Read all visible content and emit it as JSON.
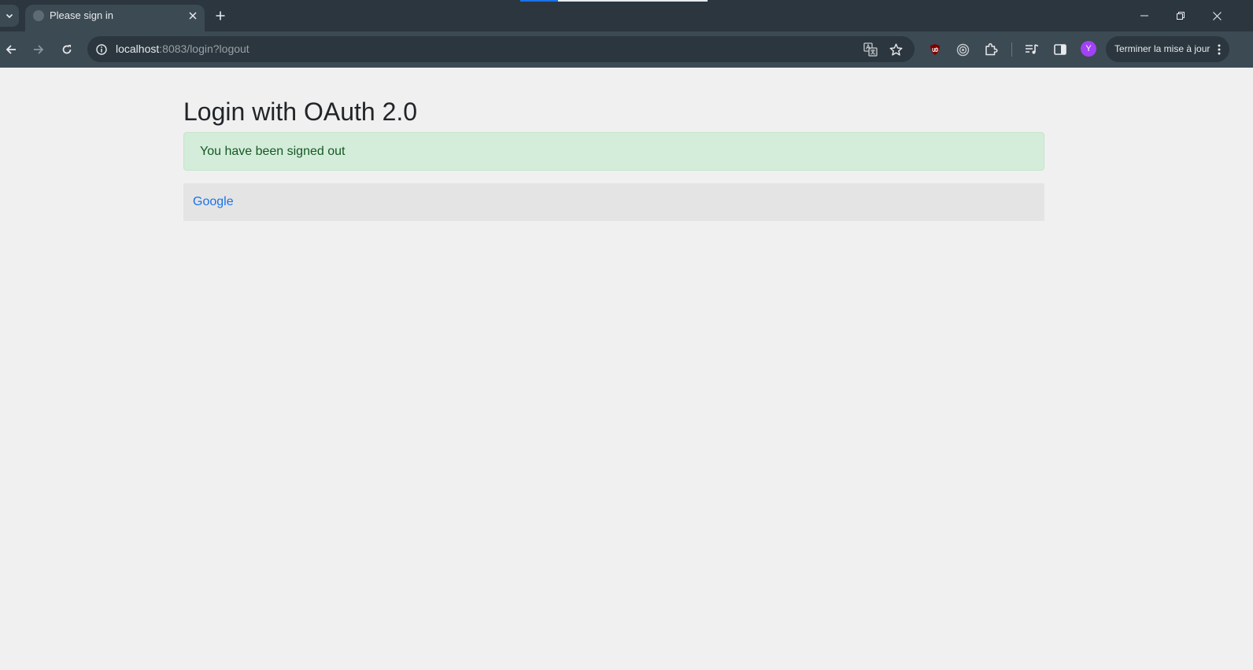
{
  "browser": {
    "tab": {
      "title": "Please sign in"
    },
    "address": {
      "host": "localhost",
      "rest": ":8083/login?logout"
    },
    "update_button": {
      "label": "Terminer la mise à jour"
    },
    "profile": {
      "initial": "Y",
      "color": "#a142f4"
    },
    "colors": {
      "tabstrip": "#2b363f",
      "toolbar": "#3c4a53"
    }
  },
  "page": {
    "title": "Login with OAuth 2.0",
    "alert": {
      "message": "You have been signed out"
    },
    "providers": [
      {
        "label": "Google"
      }
    ],
    "colors": {
      "background": "#f0f0f0",
      "alert_bg": "#d4edda",
      "alert_text": "#155724",
      "link": "#1a73e8"
    }
  }
}
